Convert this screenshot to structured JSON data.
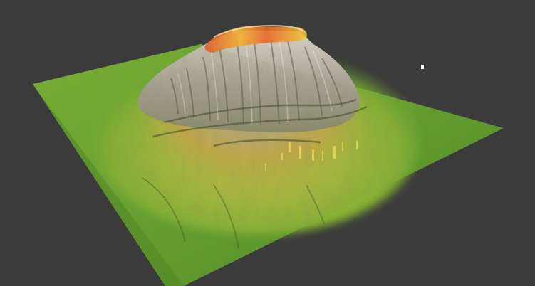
{
  "scene": {
    "background_color": "#3b3b3b",
    "plane_color": "#5e9a2a",
    "plane_edge_color": "#4f8a22",
    "colors": {
      "lowland": "#6aa82e",
      "midland": "#9bbd3a",
      "ochre": "#c9a83e",
      "rock": "#a8a294",
      "rock_light": "#d6d0c4",
      "summit_yellow": "#f0c030",
      "summit_orange": "#e8702a",
      "summit_red": "#d8402a",
      "shadow": "#3f4a2a"
    },
    "icons": {
      "cursor": "white-pointer-dot"
    }
  }
}
